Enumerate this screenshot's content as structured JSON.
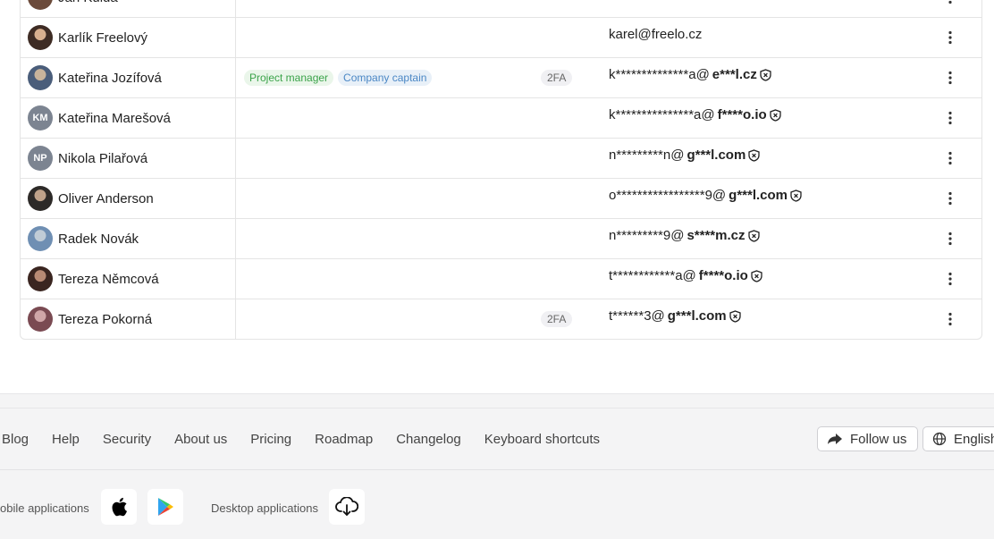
{
  "users": [
    {
      "name": "Jan Kulda",
      "avatar": "photo",
      "tags": [],
      "twofa": "",
      "email_plain": "",
      "email_bold": "",
      "email_tail": "",
      "protected": false
    },
    {
      "name": "Karlík Freelový",
      "avatar": "photo",
      "tags": [],
      "twofa": "",
      "email_plain": "karel@freelo.cz",
      "email_bold": "",
      "email_tail": "",
      "protected": false
    },
    {
      "name": "Kateřina Jozífová",
      "avatar": "photo",
      "tags": [
        {
          "label": "Project manager",
          "color": "#3ba34a"
        },
        {
          "label": "Company captain",
          "color": "#4b87c5"
        }
      ],
      "twofa": "2FA",
      "email_plain": "k**************a@",
      "email_bold": "e***l.cz",
      "email_tail": "",
      "protected": true
    },
    {
      "name": "Kateřina Marešová",
      "avatar": "KM",
      "tags": [],
      "twofa": "",
      "email_plain": "k***************a@",
      "email_bold": "f****o.io",
      "email_tail": "",
      "protected": true
    },
    {
      "name": "Nikola Pilařová",
      "avatar": "NP",
      "tags": [],
      "twofa": "",
      "email_plain": "n*********n@",
      "email_bold": "g***l.com",
      "email_tail": "",
      "protected": true
    },
    {
      "name": "Oliver Anderson",
      "avatar": "photo",
      "tags": [],
      "twofa": "",
      "email_plain": "o*****************9@",
      "email_bold": "g***l.com",
      "email_tail": "",
      "protected": true
    },
    {
      "name": "Radek Novák",
      "avatar": "photo",
      "tags": [],
      "twofa": "",
      "email_plain": "n*********9@",
      "email_bold": "s****m.cz",
      "email_tail": "",
      "protected": true
    },
    {
      "name": "Tereza Němcová",
      "avatar": "photo",
      "tags": [],
      "twofa": "",
      "email_plain": "t************a@",
      "email_bold": "f****o.io",
      "email_tail": "",
      "protected": true
    },
    {
      "name": "Tereza Pokorná",
      "avatar": "photo",
      "tags": [],
      "twofa": "2FA",
      "email_plain": "t******3@",
      "email_bold": "g***l.com",
      "email_tail": "",
      "protected": true
    }
  ],
  "footer": {
    "links": [
      "Blog",
      "Help",
      "Security",
      "About us",
      "Pricing",
      "Roadmap",
      "Changelog",
      "Keyboard shortcuts"
    ],
    "follow_label": "Follow us",
    "language_label": "English",
    "mobile_label": "obile applications",
    "desktop_label": "Desktop applications"
  },
  "icons": {
    "menu": "kebab-icon",
    "protected": "shield-x-icon",
    "apple": "apple-icon",
    "play": "google-play-icon",
    "download": "cloud-download-icon",
    "share": "share-arrow-icon",
    "globe": "globe-icon"
  }
}
